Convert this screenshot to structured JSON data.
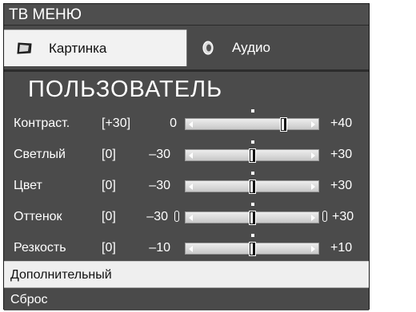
{
  "menu": {
    "title": "ТВ МЕНЮ"
  },
  "tabs": [
    {
      "label": "Картинка",
      "icon": "tv-icon"
    },
    {
      "label": "Аудио",
      "icon": "speaker-icon"
    }
  ],
  "section": {
    "title": "ПОЛЬЗОВАТЕЛЬ"
  },
  "adjustments": [
    {
      "name": "Контраст.",
      "current": "[+30]",
      "min": "0",
      "max": "+40",
      "level": 0.75
    },
    {
      "name": "Светлый",
      "current": "[0]",
      "min": "–30",
      "max": "+30",
      "level": 0.5
    },
    {
      "name": "Цвет",
      "current": "[0]",
      "min": "–30",
      "max": "+30",
      "level": 0.5
    },
    {
      "name": "Оттенок",
      "current": "[0]",
      "min": "–30",
      "max": "+30",
      "level": 0.5
    },
    {
      "name": "Резкость",
      "current": "[0]",
      "min": "–10",
      "max": "+10",
      "level": 0.5
    }
  ],
  "items": {
    "advanced": "Дополнительный",
    "reset": "Сброс"
  },
  "colors": {
    "panel": "#4a4a4a",
    "selected": "#efefef",
    "text": "#ffffff"
  }
}
